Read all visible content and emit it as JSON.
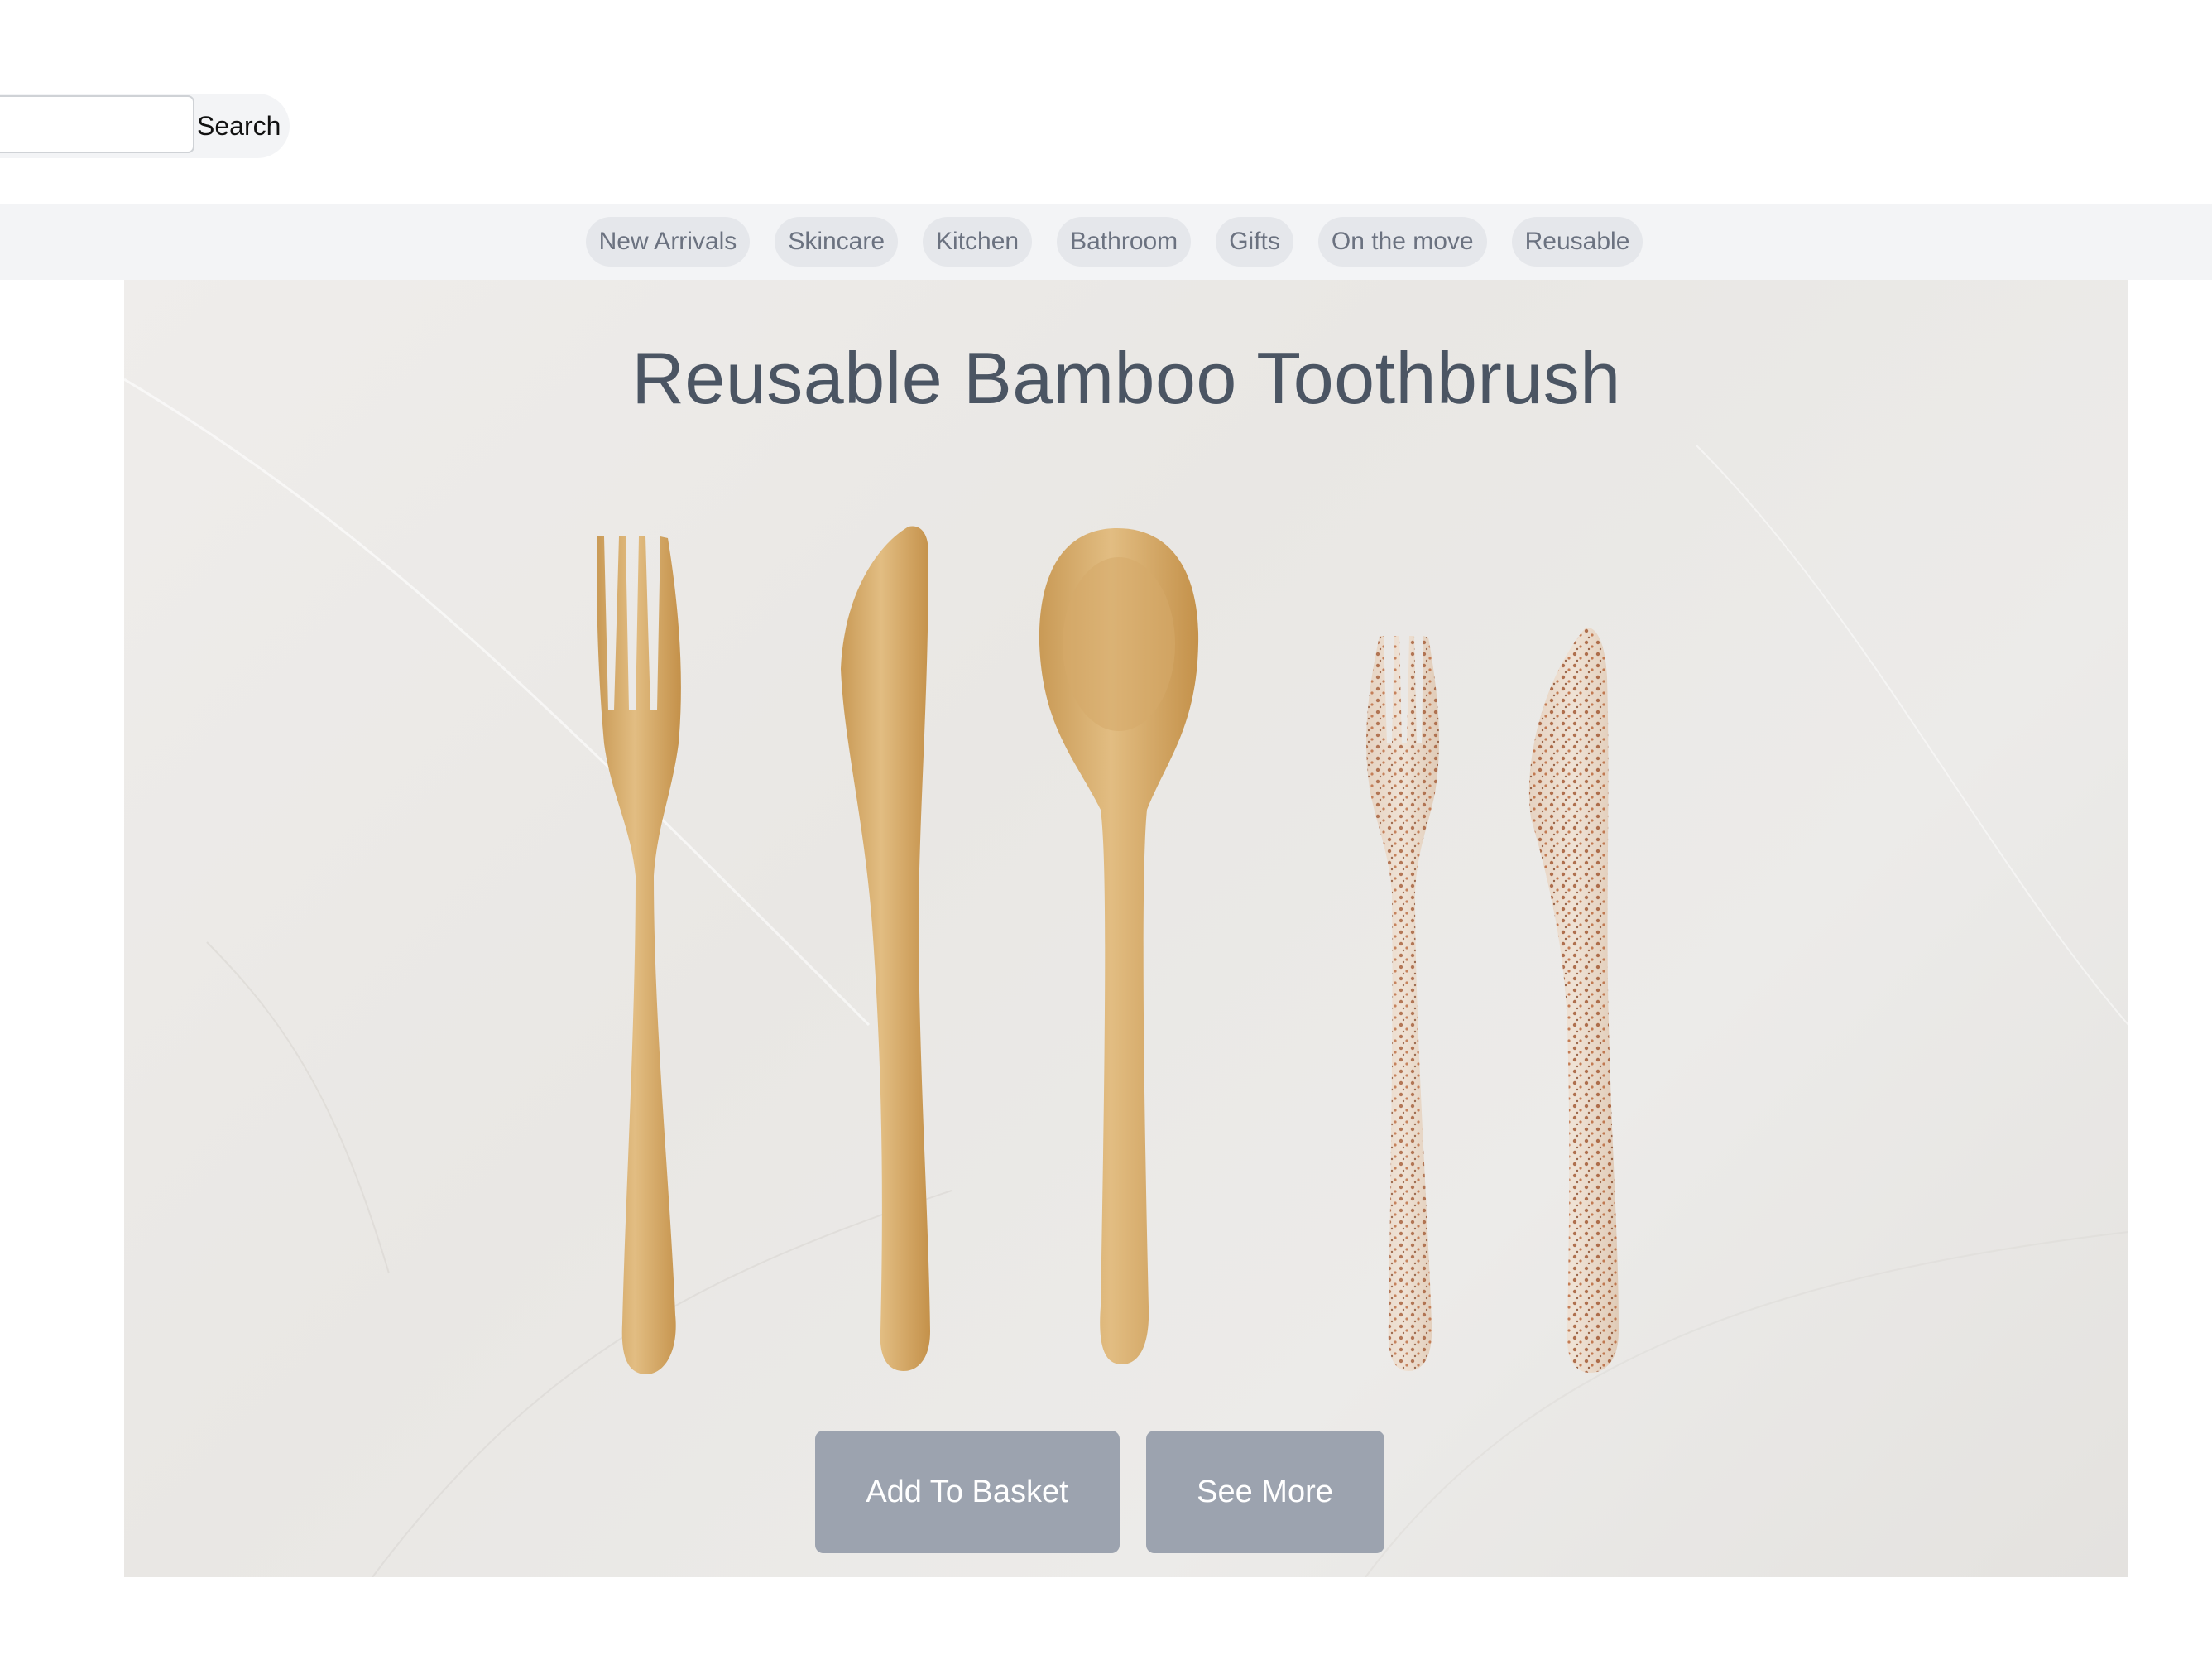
{
  "search": {
    "placeholder": "",
    "button_label": "Search"
  },
  "nav": {
    "items": [
      {
        "label": "New Arrivals"
      },
      {
        "label": "Skincare"
      },
      {
        "label": "Kitchen"
      },
      {
        "label": "Bathroom"
      },
      {
        "label": "Gifts"
      },
      {
        "label": "On the move"
      },
      {
        "label": "Reusable"
      }
    ]
  },
  "hero": {
    "title": "Reusable Bamboo Toothbrush",
    "add_to_basket_label": "Add To Basket",
    "see_more_label": "See More"
  },
  "colors": {
    "button_bg": "#9ca3af",
    "nav_bg": "#f3f4f6",
    "pill_bg": "#e5e7eb",
    "title_color": "#4b5563"
  }
}
